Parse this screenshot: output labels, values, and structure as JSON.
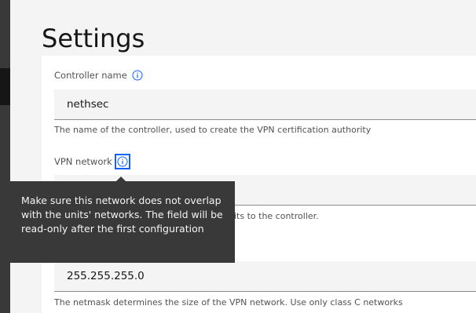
{
  "page": {
    "title": "Settings"
  },
  "colors": {
    "accent": "#0f62fe",
    "sidebar": "#393939",
    "tooltip_bg": "#393939"
  },
  "fields": {
    "controller_name": {
      "label": "Controller name",
      "value": "nethsec",
      "helper": "The name of the controller, used to create the VPN certification authority",
      "icon": "info-icon"
    },
    "vpn_network": {
      "label": "VPN network",
      "value": "",
      "helper_visible_fragment": "its to the controller.",
      "icon": "info-icon"
    },
    "netmask": {
      "value": "255.255.255.0",
      "helper": "The netmask determines the size of the VPN network. Use only class C networks"
    }
  },
  "tooltip": {
    "text": "Make sure this network does not overlap with the units' networks. The field will be read-only after the first configuration"
  }
}
